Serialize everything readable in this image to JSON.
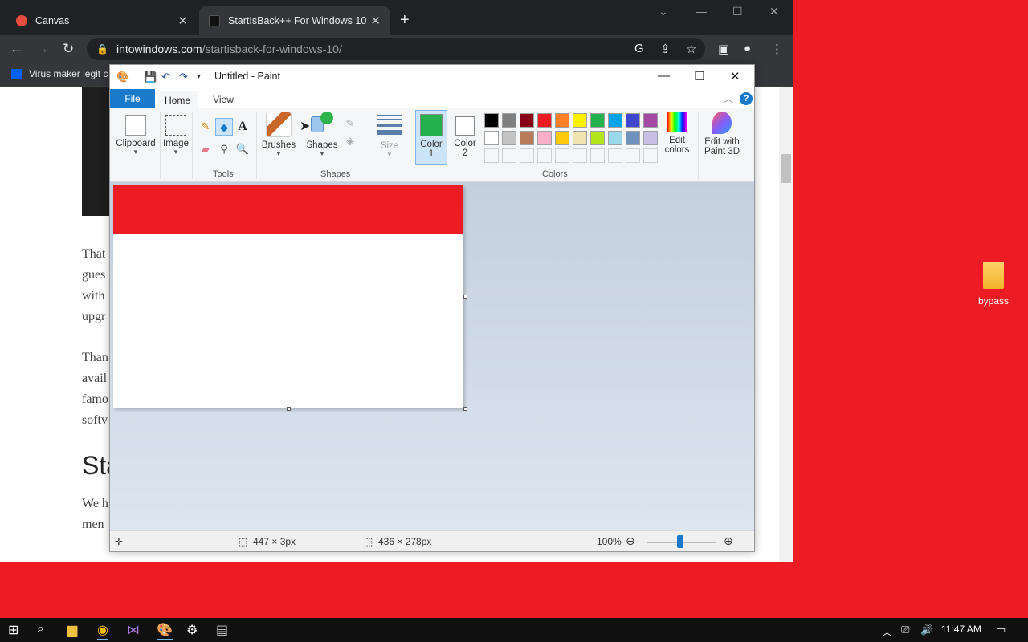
{
  "browser": {
    "tabs": [
      {
        "title": "Canvas",
        "favicon_color": "#e74c3c"
      },
      {
        "title": "StartIsBack++ For Windows 10",
        "favicon_color": "#111111"
      }
    ],
    "url_domain": "intowindows.com",
    "url_path": "/startisback-for-windows-10/",
    "bookmark": "Virus maker legit c"
  },
  "page": {
    "para1": [
      "That",
      "gues",
      "with",
      "upgr"
    ],
    "para2": [
      "Than",
      "avail",
      "famo",
      "softv"
    ],
    "heading": "Sta",
    "para3": [
      "We h",
      "men"
    ]
  },
  "paint": {
    "title": "Untitled - Paint",
    "tabs": {
      "file": "File",
      "home": "Home",
      "view": "View"
    },
    "groups": {
      "clipboard": "Clipboard",
      "image": "Image",
      "tools": "Tools",
      "brushes": "Brushes",
      "shapes_btn": "Shapes",
      "shapes": "Shapes",
      "size": "Size",
      "color1": "Color",
      "color1_num": "1",
      "color2": "Color",
      "color2_num": "2",
      "colors": "Colors",
      "edit_colors_1": "Edit",
      "edit_colors_2": "colors",
      "paint3d_1": "Edit with",
      "paint3d_2": "Paint 3D"
    },
    "palette_row1": [
      "#000000",
      "#7f7f7f",
      "#880015",
      "#ed1c24",
      "#ff7f27",
      "#fff200",
      "#22b14c",
      "#00a2e8",
      "#3f48cc",
      "#a349a4"
    ],
    "palette_row2": [
      "#ffffff",
      "#c3c3c3",
      "#b97a57",
      "#ffaec9",
      "#ffc90e",
      "#efe4b0",
      "#b5e61d",
      "#99d9ea",
      "#7092be",
      "#c8bfe7"
    ],
    "color1_value": "#22b14c",
    "color2_value": "#ffffff",
    "canvas_fill": "#ed1c24",
    "status": {
      "selection": "447 × 3px",
      "size": "436 × 278px",
      "zoom": "100%"
    }
  },
  "desktop": {
    "icon_label": "bypass"
  },
  "taskbar": {
    "time": "11:47 AM"
  }
}
